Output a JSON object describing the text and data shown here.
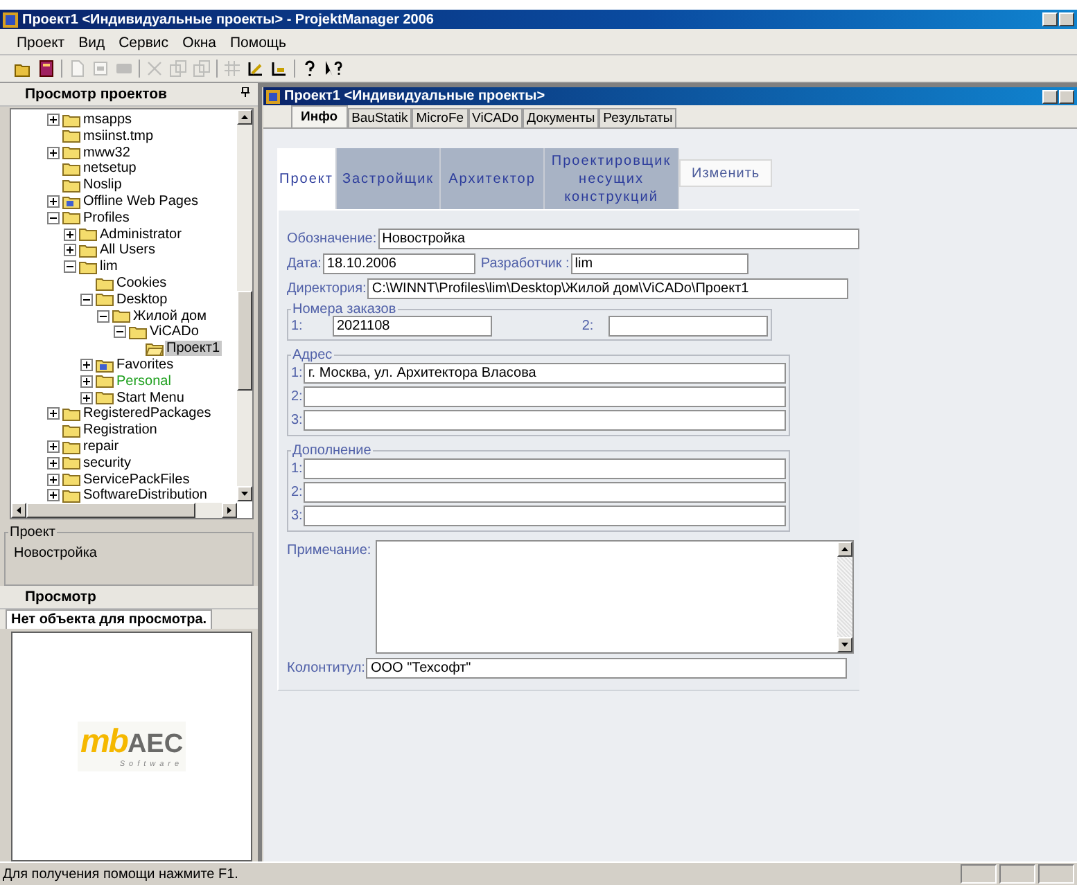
{
  "window": {
    "title": "Проект1 <Индивидуальные проекты> - ProjektManager 2006"
  },
  "menu": [
    "Проект",
    "Вид",
    "Сервис",
    "Окна",
    "Помощь"
  ],
  "toolbar": [
    {
      "kind": "open",
      "disabled": false
    },
    {
      "kind": "book",
      "disabled": false
    },
    {
      "kind": "sep"
    },
    {
      "kind": "new",
      "disabled": true
    },
    {
      "kind": "page",
      "disabled": true
    },
    {
      "kind": "card",
      "disabled": true
    },
    {
      "kind": "sep"
    },
    {
      "kind": "cut",
      "disabled": true
    },
    {
      "kind": "copy",
      "disabled": true
    },
    {
      "kind": "paste",
      "disabled": true
    },
    {
      "kind": "sep"
    },
    {
      "kind": "grid",
      "disabled": true
    },
    {
      "kind": "angle",
      "disabled": false
    },
    {
      "kind": "step",
      "disabled": false
    },
    {
      "kind": "sep"
    },
    {
      "kind": "help",
      "disabled": false
    },
    {
      "kind": "context-help",
      "disabled": false
    }
  ],
  "project_browser": {
    "title": "Просмотр проектов",
    "tree": [
      {
        "label": "msapps",
        "kind": "branch",
        "expanded": false,
        "selected": false
      },
      {
        "label": "msiinst.tmp",
        "kind": "leaf",
        "selected": false
      },
      {
        "label": "mww32",
        "kind": "branch",
        "expanded": false,
        "selected": false
      },
      {
        "label": "netsetup",
        "kind": "leaf",
        "selected": false
      },
      {
        "label": "Noslip",
        "kind": "leaf",
        "selected": false
      },
      {
        "label": "Offline Web Pages",
        "kind": "special-branch",
        "expanded": false,
        "selected": false
      },
      {
        "label": "Profiles",
        "kind": "branch",
        "expanded": true,
        "selected": false,
        "children": [
          {
            "label": "Administrator",
            "kind": "branch",
            "expanded": false,
            "selected": false
          },
          {
            "label": "All Users",
            "kind": "branch",
            "expanded": false,
            "selected": false
          },
          {
            "label": "lim",
            "kind": "branch",
            "expanded": true,
            "selected": false,
            "children": [
              {
                "label": "Cookies",
                "kind": "leaf",
                "selected": false
              },
              {
                "label": "Desktop",
                "kind": "branch",
                "expanded": true,
                "selected": false,
                "children": [
                  {
                    "label": "Жилой дом",
                    "kind": "branch",
                    "expanded": true,
                    "selected": false,
                    "children": [
                      {
                        "label": "ViCADo",
                        "kind": "branch",
                        "expanded": true,
                        "selected": false,
                        "children": [
                          {
                            "label": "Проект1",
                            "kind": "open-leaf",
                            "selected": true
                          }
                        ]
                      }
                    ]
                  }
                ]
              },
              {
                "label": "Favorites",
                "kind": "special-branch",
                "expanded": false,
                "selected": false
              },
              {
                "label": "Personal",
                "kind": "branch",
                "expanded": false,
                "selected": false,
                "color": "#1fa01f"
              },
              {
                "label": "Start Menu",
                "kind": "branch",
                "expanded": false,
                "selected": false
              }
            ]
          }
        ]
      },
      {
        "label": "RegisteredPackages",
        "kind": "branch",
        "expanded": false,
        "selected": false
      },
      {
        "label": "Registration",
        "kind": "leaf",
        "selected": false
      },
      {
        "label": "repair",
        "kind": "branch",
        "expanded": false,
        "selected": false
      },
      {
        "label": "security",
        "kind": "branch",
        "expanded": false,
        "selected": false
      },
      {
        "label": "ServicePackFiles",
        "kind": "branch",
        "expanded": false,
        "selected": false
      },
      {
        "label": "SoftwareDistribution",
        "kind": "branch",
        "expanded": false,
        "selected": false
      }
    ]
  },
  "project_box": {
    "legend": "Проект",
    "value": "Новостройка"
  },
  "preview": {
    "title": "Просмотр",
    "tab": "Нет объекта для просмотра.",
    "logo": {
      "mark": "mb",
      "name": "AEC",
      "tagline": "Software"
    }
  },
  "child_window": {
    "title": "Проект1 <Индивидуальные проекты>",
    "tabs": [
      {
        "label": "Инфо",
        "selected": true
      },
      {
        "label": "BauStatik",
        "selected": false
      },
      {
        "label": "MicroFe",
        "selected": false
      },
      {
        "label": "ViCADo",
        "selected": false
      },
      {
        "label": "Документы",
        "selected": false
      },
      {
        "label": "Результаты",
        "selected": false
      }
    ],
    "subtabs": [
      {
        "label": "Проект",
        "selected": true
      },
      {
        "label": "Застройщик",
        "selected": false
      },
      {
        "label": "Архитектор",
        "selected": false
      },
      {
        "label": "Проектировщик несущих конструкций",
        "selected": false
      }
    ],
    "edit_button": "Изменить",
    "form": {
      "designation": {
        "label": "Обозначение:",
        "value": "Новостройка"
      },
      "date": {
        "label": "Дата:",
        "value": "18.10.2006"
      },
      "developer": {
        "label": "Разработчик :",
        "value": "lim"
      },
      "directory": {
        "label": "Директория:",
        "value": "C:\\WINNT\\Profiles\\lim\\Desktop\\Жилой дом\\ViCADo\\Проект1"
      },
      "orders": {
        "legend": "Номера заказов",
        "items": [
          {
            "label": "1:",
            "value": "2021108"
          },
          {
            "label": "2:"
          }
        ]
      },
      "address": {
        "legend": "Адрес",
        "items": [
          {
            "label": "1:",
            "value": "г. Москва, ул. Архитектора Власова"
          },
          {
            "label": "2:"
          },
          {
            "label": "3:"
          }
        ]
      },
      "addition": {
        "legend": "Дополнение",
        "items": [
          {
            "label": "1:"
          },
          {
            "label": "2:"
          },
          {
            "label": "3:"
          }
        ]
      },
      "note": {
        "label": "Примечание:"
      },
      "footer": {
        "label": "Колонтитул:",
        "value": "ООО \"Техсофт\""
      }
    }
  },
  "status_bar": {
    "text": "Для получения помощи нажмите F1."
  }
}
